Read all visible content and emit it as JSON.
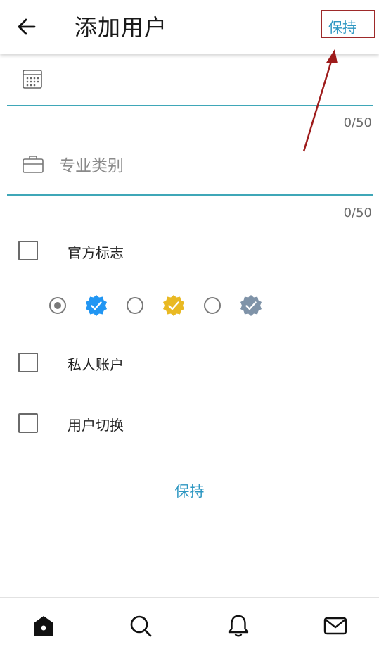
{
  "header": {
    "title": "添加用户",
    "save_label": "保持",
    "back_icon": "arrow-left-icon"
  },
  "fields": [
    {
      "icon": "calendar-icon",
      "placeholder": "",
      "counter": "0/50"
    },
    {
      "icon": "briefcase-icon",
      "placeholder": "专业类别",
      "counter": "0/50"
    }
  ],
  "checkboxes": [
    {
      "label": "官方标志",
      "checked": false
    },
    {
      "label": "私人账户",
      "checked": false
    },
    {
      "label": "用户切换",
      "checked": false
    }
  ],
  "badge_options": [
    {
      "type": "radio",
      "selected": true
    },
    {
      "type": "badge",
      "color": "#2196f3"
    },
    {
      "type": "radio",
      "selected": false
    },
    {
      "type": "badge",
      "color": "#e9b923"
    },
    {
      "type": "radio",
      "selected": false
    },
    {
      "type": "badge",
      "color": "#7f93a8"
    }
  ],
  "footer": {
    "save_label": "保持"
  },
  "colors": {
    "accent": "#2e97c2",
    "underline": "#3fa7b8",
    "highlight_box": "#9e2a2a"
  },
  "bottom_nav": [
    {
      "icon": "home-icon"
    },
    {
      "icon": "search-icon"
    },
    {
      "icon": "bell-icon"
    },
    {
      "icon": "mail-icon"
    }
  ]
}
